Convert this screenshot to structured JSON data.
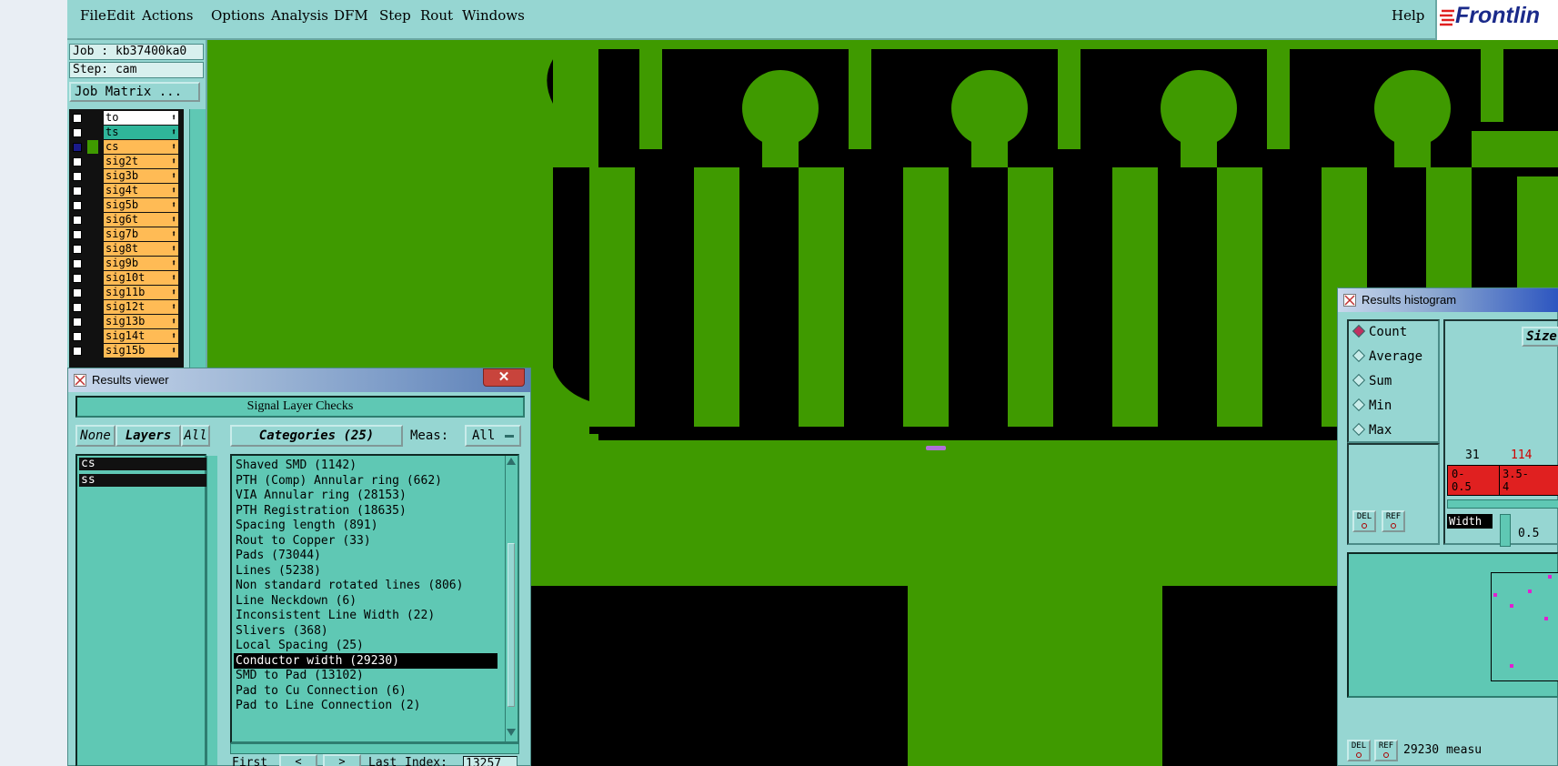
{
  "menu": {
    "items": [
      {
        "label": "File",
        "x": 0
      },
      {
        "label": "Edit",
        "x": 0
      },
      {
        "label": "Actions",
        "x": 0
      },
      {
        "label": "Options",
        "x": 0
      },
      {
        "label": "Analysis",
        "x": 0
      },
      {
        "label": "DFM",
        "x": 0
      },
      {
        "label": "Step",
        "x": 0
      },
      {
        "label": "Rout",
        "x": 0
      },
      {
        "label": "Windows",
        "x": 0
      }
    ],
    "help": "Help",
    "logo": "Frontlin"
  },
  "left_panel": {
    "job": "Job : kb37400ka0",
    "step": "Step: cam",
    "job_matrix": "Job Matrix ..."
  },
  "layers": [
    {
      "name": "to",
      "bg": "#ffffff",
      "color": "#111111",
      "checked": false
    },
    {
      "name": "ts",
      "bg": "#2fb59a",
      "color": "#111111",
      "checked": false
    },
    {
      "name": "cs",
      "bg": "#ffbb55",
      "color": "#3f9a00",
      "checked": true
    },
    {
      "name": "sig2t",
      "bg": "#ffbb55",
      "color": "#111111",
      "checked": false
    },
    {
      "name": "sig3b",
      "bg": "#ffbb55",
      "color": "#111111",
      "checked": false
    },
    {
      "name": "sig4t",
      "bg": "#ffbb55",
      "color": "#111111",
      "checked": false
    },
    {
      "name": "sig5b",
      "bg": "#ffbb55",
      "color": "#111111",
      "checked": false
    },
    {
      "name": "sig6t",
      "bg": "#ffbb55",
      "color": "#111111",
      "checked": false
    },
    {
      "name": "sig7b",
      "bg": "#ffbb55",
      "color": "#111111",
      "checked": false
    },
    {
      "name": "sig8t",
      "bg": "#ffbb55",
      "color": "#111111",
      "checked": false
    },
    {
      "name": "sig9b",
      "bg": "#ffbb55",
      "color": "#111111",
      "checked": false
    },
    {
      "name": "sig10t",
      "bg": "#ffbb55",
      "color": "#111111",
      "checked": false
    },
    {
      "name": "sig11b",
      "bg": "#ffbb55",
      "color": "#111111",
      "checked": false
    },
    {
      "name": "sig12t",
      "bg": "#ffbb55",
      "color": "#111111",
      "checked": false
    },
    {
      "name": "sig13b",
      "bg": "#ffbb55",
      "color": "#111111",
      "checked": false
    },
    {
      "name": "sig14t",
      "bg": "#ffbb55",
      "color": "#111111",
      "checked": false
    },
    {
      "name": "sig15b",
      "bg": "#ffbb55",
      "color": "#111111",
      "checked": false
    }
  ],
  "results_viewer": {
    "title": "Results viewer",
    "close": "✕",
    "header": "Signal Layer Checks",
    "none_btn": "None",
    "layers_btn": "Layers",
    "all_btn": "All",
    "categories_btn": "Categories (25)",
    "meas_label": "Meas:",
    "meas_value": "All",
    "layer_items": [
      "cs",
      "ss"
    ],
    "categories": [
      "Shaved SMD (1142)",
      "PTH (Comp) Annular ring (662)",
      "VIA Annular ring (28153)",
      "PTH Registration (18635)",
      "Spacing length (891)",
      "Rout to Copper (33)",
      "Pads (73044)",
      "Lines (5238)",
      "Non standard rotated lines (806)",
      "Line Neckdown (6)",
      "Inconsistent Line Width (22)",
      "Slivers (368)",
      "Local Spacing (25)",
      "Conductor width (29230)",
      "SMD to Pad (13102)",
      "Pad to Cu Connection (6)",
      "Pad to Line Connection (2)"
    ],
    "selected_index": 13,
    "bottom": {
      "first": "First",
      "prev": "<",
      "next": ">",
      "last": "Last",
      "index_label": "Index:",
      "index_value": "13257"
    }
  },
  "histogram": {
    "title": "Results histogram",
    "radios": [
      {
        "label": "Count",
        "on": true
      },
      {
        "label": "Average",
        "on": false
      },
      {
        "label": "Sum",
        "on": false
      },
      {
        "label": "Min",
        "on": false
      },
      {
        "label": "Max",
        "on": false
      }
    ],
    "size_btn": "Size",
    "bar_counts": [
      "31",
      "114"
    ],
    "bar_labels": [
      "0-\n0.5",
      "3.5-\n4"
    ],
    "width_label": "Width",
    "width_value": "0.5",
    "del": "DEL",
    "ref": "REF",
    "status": "29230 measu"
  },
  "colors": {
    "panel": "#96d6d2",
    "list": "#5fc8b4",
    "copper": "#3f9a00",
    "background": "#000000",
    "selection": "#b070d8"
  }
}
